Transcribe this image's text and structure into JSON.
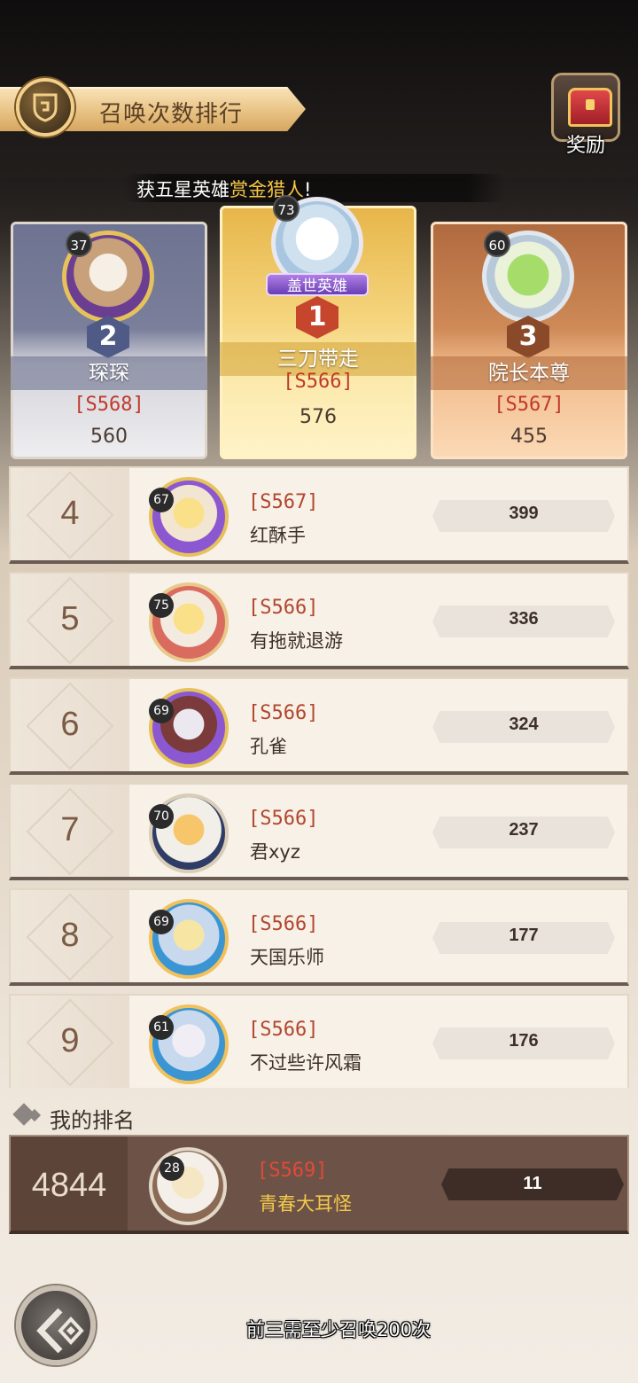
{
  "header": {
    "title": "召唤次数排行",
    "reward_label": "奖励"
  },
  "announcement": {
    "prefix": "获五星英雄",
    "highlight": "赏金猎人",
    "suffix": "!",
    "highlight_color": "#f8c646"
  },
  "podium": {
    "first": {
      "rank": "1",
      "level": "73",
      "tag": "盖世英雄",
      "name": "三刀带走",
      "server": "[S566]",
      "score": "576"
    },
    "second": {
      "rank": "2",
      "level": "37",
      "name": "琛琛",
      "server": "[S568]",
      "score": "560"
    },
    "third": {
      "rank": "3",
      "level": "60",
      "name": "院长本尊",
      "server": "[S567]",
      "score": "455"
    }
  },
  "rows": [
    {
      "rank": "4",
      "level": "67",
      "server": "[S567]",
      "name": "红酥手",
      "score": "399"
    },
    {
      "rank": "5",
      "level": "75",
      "server": "[S566]",
      "name": "有拖就退游",
      "score": "336"
    },
    {
      "rank": "6",
      "level": "69",
      "server": "[S566]",
      "name": "孔雀",
      "score": "324"
    },
    {
      "rank": "7",
      "level": "70",
      "server": "[S566]",
      "name": "君xyz",
      "score": "237"
    },
    {
      "rank": "8",
      "level": "69",
      "server": "[S566]",
      "name": "天国乐师",
      "score": "177"
    },
    {
      "rank": "9",
      "level": "61",
      "server": "[S566]",
      "name": "不过些许风霜",
      "score": "176"
    }
  ],
  "my_rank": {
    "label": "我的排名",
    "rank": "4844",
    "level": "28",
    "server": "[S569]",
    "name": "青春大耳怪",
    "score": "11"
  },
  "footnote": "前三需至少召唤200次",
  "icons": {
    "title_emblem": "shield-crest-icon",
    "reward": "treasure-chest-icon",
    "back": "back-arrow-icon"
  }
}
